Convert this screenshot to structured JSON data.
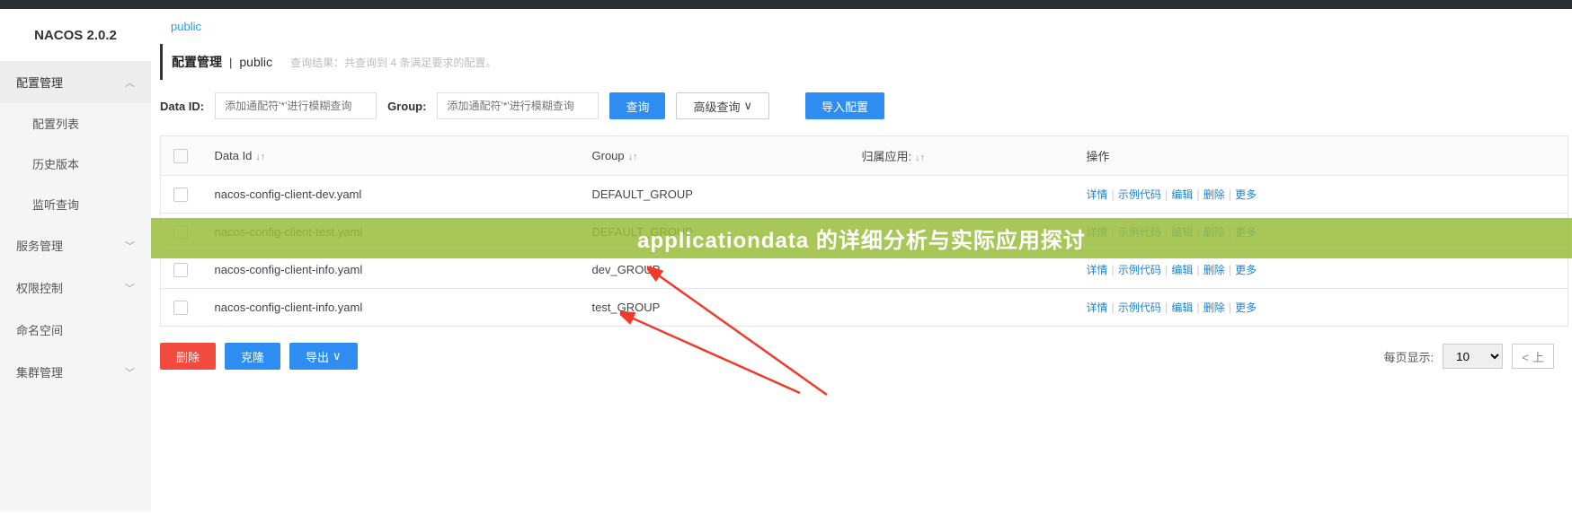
{
  "brand": "NACOS 2.0.2",
  "sidebar": {
    "items": [
      {
        "label": "配置管理",
        "type": "group",
        "expanded": true
      },
      {
        "label": "配置列表",
        "type": "sub"
      },
      {
        "label": "历史版本",
        "type": "sub"
      },
      {
        "label": "监听查询",
        "type": "sub"
      },
      {
        "label": "服务管理",
        "type": "group"
      },
      {
        "label": "权限控制",
        "type": "group"
      },
      {
        "label": "命名空间",
        "type": "item"
      },
      {
        "label": "集群管理",
        "type": "group"
      }
    ]
  },
  "namespace_tab": "public",
  "header": {
    "title": "配置管理",
    "subtitle": "public",
    "hint": "查询结果：共查询到 4 条满足要求的配置。"
  },
  "search": {
    "dataid_label": "Data ID:",
    "dataid_placeholder": "添加通配符'*'进行模糊查询",
    "group_label": "Group:",
    "group_placeholder": "添加通配符'*'进行模糊查询",
    "query_btn": "查询",
    "adv_btn": "高级查询",
    "import_btn": "导入配置"
  },
  "table": {
    "cols": {
      "dataid": "Data Id",
      "group": "Group",
      "app": "归属应用:",
      "ops": "操作"
    },
    "rows": [
      {
        "dataid": "nacos-config-client-dev.yaml",
        "group": "DEFAULT_GROUP"
      },
      {
        "dataid": "nacos-config-client-test.yaml",
        "group": "DEFAULT_GROUP"
      },
      {
        "dataid": "nacos-config-client-info.yaml",
        "group": "dev_GROUP"
      },
      {
        "dataid": "nacos-config-client-info.yaml",
        "group": "test_GROUP"
      }
    ],
    "ops": {
      "detail": "详情",
      "sample": "示例代码",
      "edit": "编辑",
      "delete": "删除",
      "more": "更多"
    }
  },
  "actions": {
    "delete": "删除",
    "clone": "克隆",
    "export": "导出"
  },
  "pager": {
    "label": "每页显示:",
    "size": "10",
    "prev": "< 上"
  },
  "overlay_text": "applicationdata 的详细分析与实际应用探讨"
}
